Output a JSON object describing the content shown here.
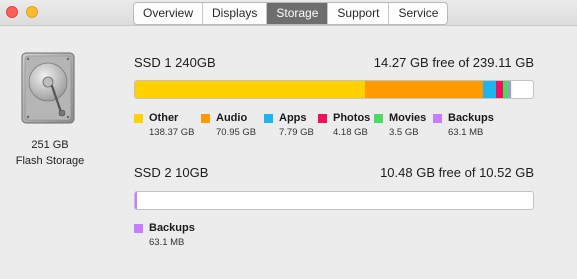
{
  "window": {
    "tabs": [
      {
        "label": "Overview",
        "active": false
      },
      {
        "label": "Displays",
        "active": false
      },
      {
        "label": "Storage",
        "active": true
      },
      {
        "label": "Support",
        "active": false
      },
      {
        "label": "Service",
        "active": false
      }
    ]
  },
  "device": {
    "capacity": "251 GB",
    "type": "Flash Storage"
  },
  "drives": [
    {
      "name": "SSD 1 240GB",
      "free_text": "14.27 GB free of 239.11 GB",
      "usage": [
        {
          "category": "Other",
          "size": "138.37 GB",
          "fraction": 0.5787,
          "color": "#ffd100"
        },
        {
          "category": "Audio",
          "size": "70.95 GB",
          "fraction": 0.2967,
          "color": "#ff9b00"
        },
        {
          "category": "Apps",
          "size": "7.79 GB",
          "fraction": 0.0326,
          "color": "#1eb4f0"
        },
        {
          "category": "Photos",
          "size": "4.18 GB",
          "fraction": 0.0175,
          "color": "#f0115a"
        },
        {
          "category": "Movies",
          "size": "3.5 GB",
          "fraction": 0.0146,
          "color": "#4cd964"
        },
        {
          "category": "Backups",
          "size": "63.1 MB",
          "fraction": 0.003,
          "color": "#c67dff"
        }
      ]
    },
    {
      "name": "SSD 2 10GB",
      "free_text": "10.48 GB free of 10.52 GB",
      "usage": [
        {
          "category": "Backups",
          "size": "63.1 MB",
          "fraction": 0.006,
          "color": "#c67dff"
        }
      ]
    }
  ]
}
